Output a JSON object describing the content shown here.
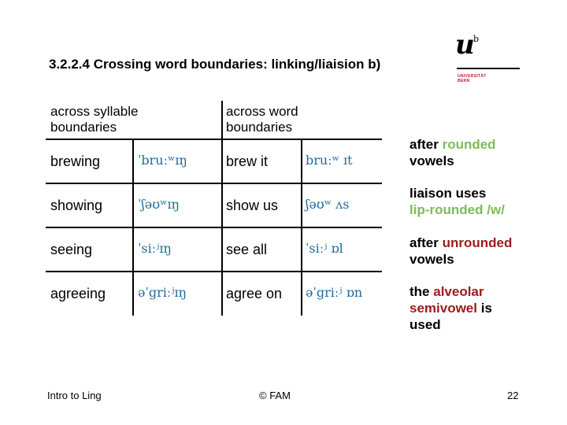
{
  "slide": {
    "title": "3.2.2.4 Crossing word boundaries: linking/liaision b)"
  },
  "logo": {
    "letter": "u",
    "superscript": "b",
    "dot": "•",
    "institution_line1": "UNIVERSITÄT",
    "institution_line2": "BERN"
  },
  "table": {
    "headers": {
      "syllable_line1": "across syllable",
      "syllable_line2": "boundaries",
      "word_line1": "across word",
      "word_line2": "boundaries"
    },
    "rows": [
      {
        "word": "brewing",
        "word_ipa": "ˈbruːʷɪŋ",
        "phrase": "brew it",
        "phrase_ipa": "bruːʷ ɪt"
      },
      {
        "word": "showing",
        "word_ipa": "ˈʃəʊʷɪŋ",
        "phrase": "show us",
        "phrase_ipa": "ʃəʊʷ ʌs"
      },
      {
        "word": "seeing",
        "word_ipa": "ˈsiːʲɪŋ",
        "phrase": "see all",
        "phrase_ipa": "ˈsiːʲ ɒl"
      },
      {
        "word": "agreeing",
        "word_ipa": "əˈgriːʲɪŋ",
        "phrase": "agree on",
        "phrase_ipa": "əˈgriːʲ ɒn"
      }
    ]
  },
  "notes": {
    "rounded": {
      "line1_prefix": "after ",
      "line1_highlight": "rounded",
      "line2": "vowels",
      "explain_line1": "liaison uses",
      "explain_highlight": "lip-rounded /w/"
    },
    "unrounded": {
      "line1_prefix": "after ",
      "line1_highlight": "unrounded",
      "line2": "vowels",
      "explain_prefix": "the ",
      "explain_highlight1": "alveolar",
      "explain_highlight2": "semivowel",
      "explain_suffix": " is",
      "explain_last": "used"
    },
    "colors": {
      "rounded_accent": "#7dbb5a",
      "unrounded_accent": "#9c1c1c",
      "ipa_text": "#1f6b99"
    }
  },
  "footer": {
    "left": "Intro to Ling",
    "center": "© FAM",
    "page_number": "22"
  }
}
